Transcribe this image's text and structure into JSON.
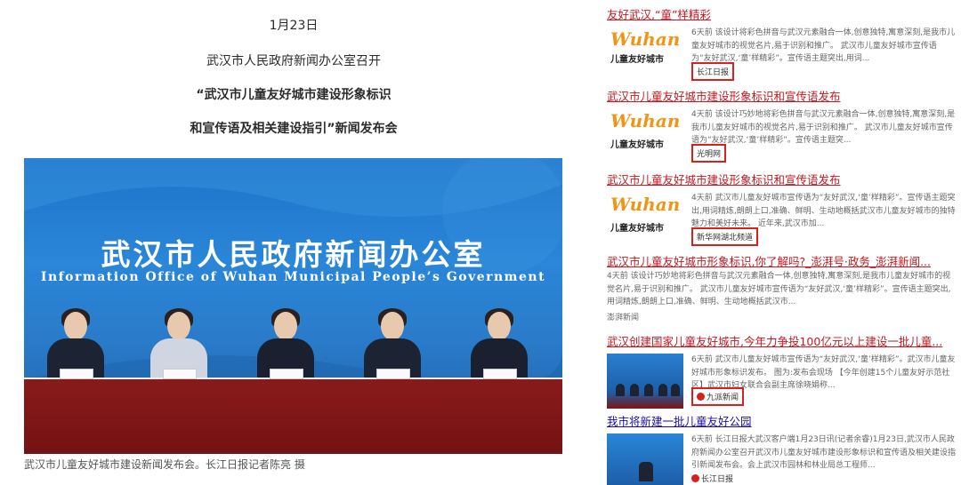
{
  "article": {
    "date": "1月23日",
    "line1": "武汉市人民政府新闻办公室召开",
    "line2": "“武汉市儿童友好城市建设形象标识",
    "line3": "和宣传语及相关建设指引”新闻发布会",
    "photo": {
      "title_cn": "武汉市人民政府新闻办公室",
      "title_en": "Information Office of Wuhan Municipal People’s Government"
    },
    "caption": "武汉市儿童友好城市建设新闻发布会。长江日报记者陈亮 摄"
  },
  "results": [
    {
      "title": "友好武汉,“童”样精彩",
      "body": "6天前 该设计将彩色拼音与武汉元素融合一体,创意独特,寓意深刻,是我市儿童友好城市的视觉名片,易于识别和推广。 武汉市儿童友好城市宣传语为“友好武汉,‘童’样精彩”。宣传语主题突出,用词...",
      "source": "长江日报",
      "logo_text": "Wuhan",
      "logo_sub": "儿童友好城市"
    },
    {
      "title": "武汉市儿童友好城市建设形象标识和宣传语发布",
      "body": "4天前 该设计巧妙地将彩色拼音与武汉元素融合一体,创意独特,寓意深刻,是我市儿童友好城市的视觉名片,易于识别和推广。 武汉市儿童友好城市宣传语为“友好武汉,‘童’样精彩”。宣传语主题突...",
      "source": "光明网",
      "logo_text": "Wuhan",
      "logo_sub": "儿童友好城市"
    },
    {
      "title": "武汉市儿童友好城市建设形象标识和宣传语发布",
      "body": "4天前 武汉市儿童友好城市宣传语为“友好武汉,‘童’样精彩”。宣传语主题突出,用词精炼,朗朗上口,准确、鲜明、生动地概括武汉市儿童友好城市的独特魅力和美好未来。 近年来,武汉市加...",
      "source": "新华网湖北频道",
      "logo_text": "Wuhan",
      "logo_sub": "儿童友好城市"
    },
    {
      "title": "武汉市儿童友好城市形象标识,你了解吗?_澎湃号·政务_澎湃新闻...",
      "body": "4天前 该设计巧妙地将彩色拼音与武汉元素融合一体,创意独特,寓意深刻,是我市儿童友好城市的视觉名片,易于识别和推广。 武汉市儿童友好城市宣传语为“友好武汉,‘童’样精彩”。宣传语主题突出,用词精炼,朗朗上口,准确、鲜明、生动地概括武汉市...",
      "source": "澎湃新闻"
    },
    {
      "title": "武汉创建国家儿童友好城市,今年力争投100亿元以上建设一批儿童...",
      "body": "6天前 武汉市儿童友好城市宣传语为“友好武汉,‘童’样精彩”。武汉市儿童友好城市形象标识发布。 图为:发布会现场 【今年创建15个儿童友好示范社区】武汉市妇女联合会副主席徐晓娟称...",
      "source": "九派新闻"
    },
    {
      "title": "我市将新建一批儿童友好公园",
      "body": "6天前 长江日报大武汉客户端1月23日讯(记者余睿)1月23日,武汉市人民政府新闻办公室召开武汉市儿童友好城市建设形象标识和宣传语及相关建设指引新闻发布会。会上武汉市园林和林业局总工程师...",
      "source": "长江日报"
    }
  ]
}
